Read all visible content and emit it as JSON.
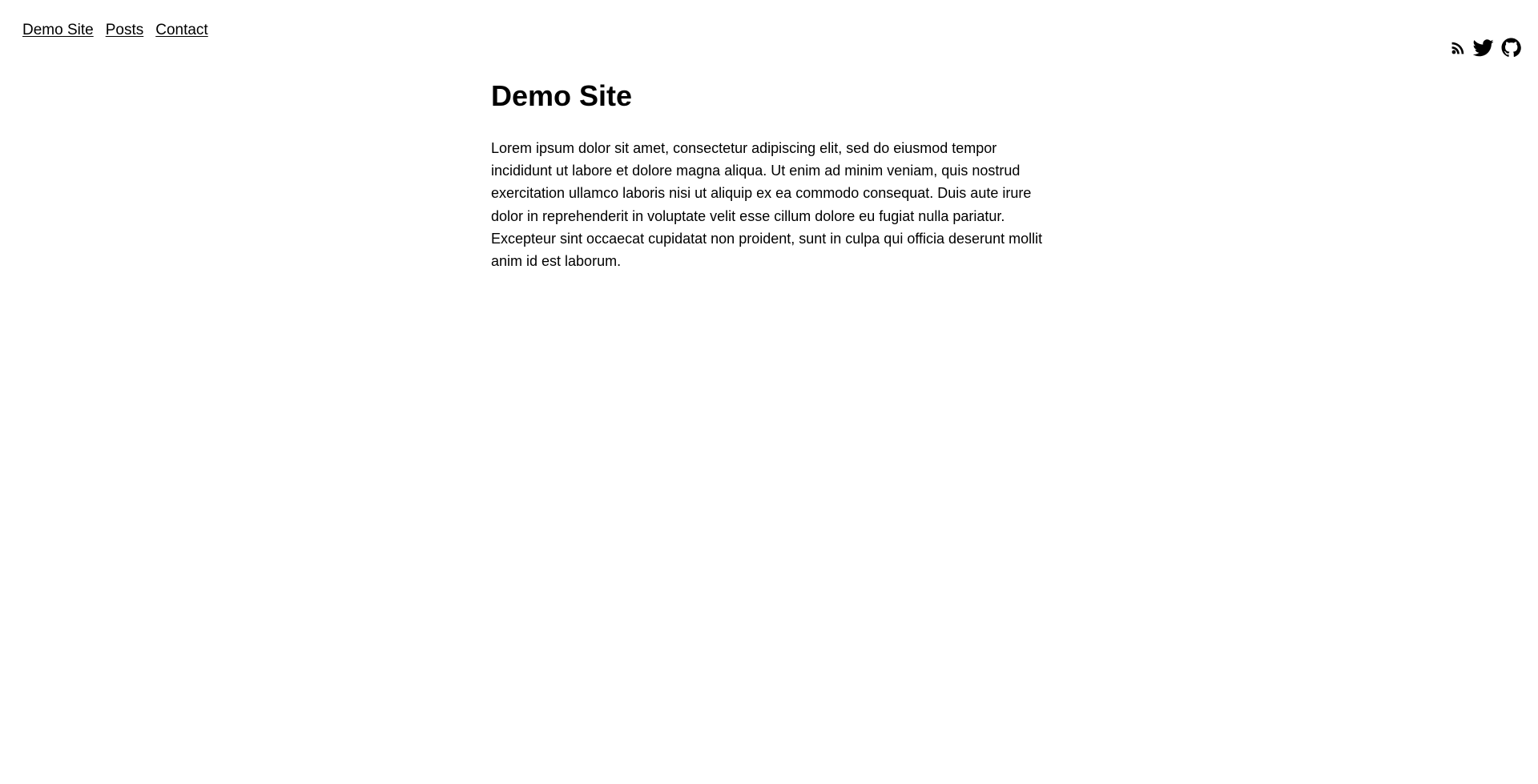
{
  "nav": {
    "items": [
      {
        "label": "Demo Site"
      },
      {
        "label": "Posts"
      },
      {
        "label": "Contact"
      }
    ]
  },
  "social": {
    "icons": [
      "rss-icon",
      "twitter-icon",
      "github-icon"
    ]
  },
  "main": {
    "title": "Demo Site",
    "body": "Lorem ipsum dolor sit amet, consectetur adipiscing elit, sed do eiusmod tempor incididunt ut labore et dolore magna aliqua. Ut enim ad minim veniam, quis nostrud exercitation ullamco laboris nisi ut aliquip ex ea commodo consequat. Duis aute irure dolor in reprehenderit in voluptate velit esse cillum dolore eu fugiat nulla pariatur. Excepteur sint occaecat cupidatat non proident, sunt in culpa qui officia deserunt mollit anim id est laborum."
  }
}
